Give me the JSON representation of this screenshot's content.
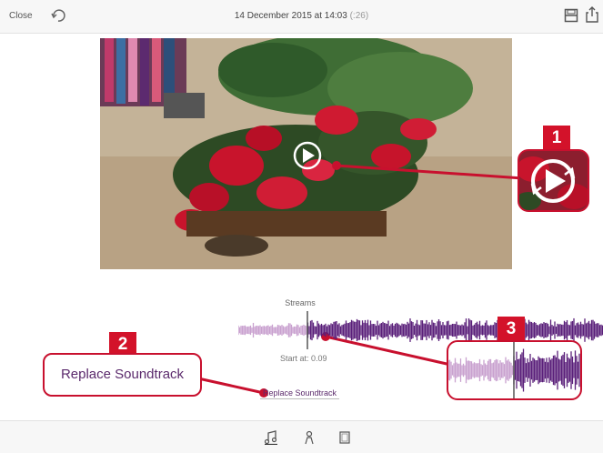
{
  "topbar": {
    "close_label": "Close",
    "title": "14 December 2015 at 14:03",
    "duration": "(:26)"
  },
  "icons": {
    "undo": "undo-icon",
    "save": "save-icon",
    "share": "share-icon",
    "play": "play-icon",
    "music": "music-note-icon",
    "person": "person-icon",
    "frame": "frame-icon"
  },
  "callouts": {
    "one": "1",
    "two": "2",
    "three": "3",
    "replace_label": "Replace Soundtrack"
  },
  "audio": {
    "streams_label": "Streams",
    "start_at": "Start at: 0.09",
    "replace_button": "Replace Soundtrack"
  },
  "colors": {
    "accent": "#c8102e",
    "wave_played": "#c9a1cf",
    "wave_unplayed": "#5a1f7a",
    "text_purple": "#5b2a6c"
  }
}
